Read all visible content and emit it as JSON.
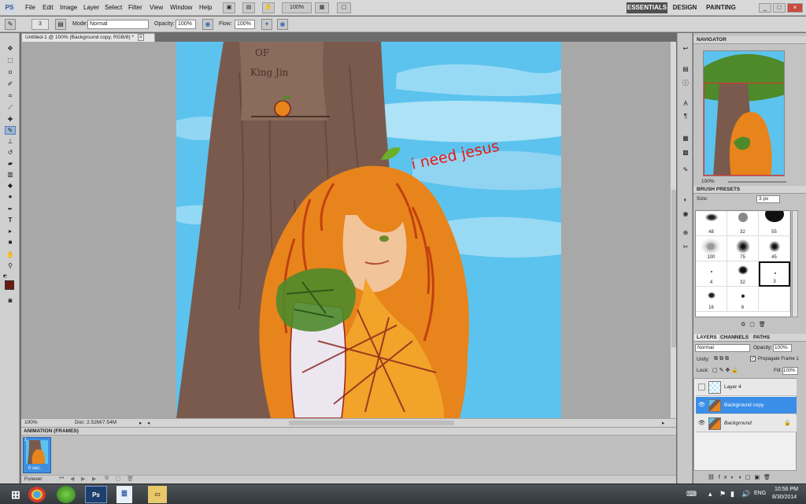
{
  "app": {
    "logo": "PS"
  },
  "menu": [
    "File",
    "Edit",
    "Image",
    "Layer",
    "Select",
    "Filter",
    "View",
    "Window",
    "Help"
  ],
  "menubar_controls": {
    "zoom": "100%"
  },
  "workspaces": [
    {
      "label": "ESSENTIALS",
      "active": true
    },
    {
      "label": "DESIGN",
      "active": false
    },
    {
      "label": "PAINTING",
      "active": false
    }
  ],
  "options": {
    "brush_size": "3",
    "mode_label": "Mode:",
    "mode_value": "Normal",
    "opacity_label": "Opacity:",
    "opacity_value": "100%",
    "flow_label": "Flow:",
    "flow_value": "100%"
  },
  "document": {
    "tab_title": "Untitled-1 @ 100% (Background copy, RGB/8) *",
    "close_glyph": "×",
    "zoom": "100%",
    "doc_info": "Doc: 2.52M/7.54M"
  },
  "artwork": {
    "handwriting": "i need jesus",
    "sign_line1": "OF",
    "sign_line2": "King Jin"
  },
  "animation": {
    "panel_title": "ANIMATION (FRAMES)",
    "frame_number": "1",
    "frame_delay": "0 sec.",
    "loop": "Forever"
  },
  "navigator": {
    "title": "NAVIGATOR",
    "zoom": "100%"
  },
  "brush_presets": {
    "title": "BRUSH PRESETS",
    "size_label": "Size:",
    "size_value": "3 px",
    "cells": [
      {
        "n": "48"
      },
      {
        "n": "32"
      },
      {
        "n": "55"
      },
      {
        "n": "100"
      },
      {
        "n": "75"
      },
      {
        "n": "45"
      },
      {
        "n": "4"
      },
      {
        "n": "32"
      },
      {
        "n": "3"
      },
      {
        "n": "16"
      },
      {
        "n": "6"
      },
      {
        "n": ""
      }
    ]
  },
  "layers_panel": {
    "tabs": [
      "LAYERS",
      "CHANNELS",
      "PATHS"
    ],
    "blend_mode": "Normal",
    "opacity_label": "Opacity:",
    "opacity_value": "100%",
    "unify_label": "Unify:",
    "propagate_label": "Propagate Frame 1",
    "lock_label": "Lock:",
    "fill_label": "Fill:",
    "fill_value": "100%",
    "layers": [
      {
        "name": "Layer 4",
        "visible": false,
        "selected": false
      },
      {
        "name": "Background copy",
        "visible": true,
        "selected": true
      },
      {
        "name": "Background",
        "visible": true,
        "selected": false
      }
    ]
  },
  "taskbar": {
    "lang": "ENG",
    "time": "10:56 PM",
    "date": "8/30/2014",
    "ps_label": "Ps"
  },
  "colors": {
    "accent": "#3b8ee8",
    "foreground_swatch": "#6b1a12",
    "sky": "#5cc3ee",
    "hair": "#e8841c",
    "trunk": "#7a5a4c",
    "handwriting": "#e81818"
  }
}
